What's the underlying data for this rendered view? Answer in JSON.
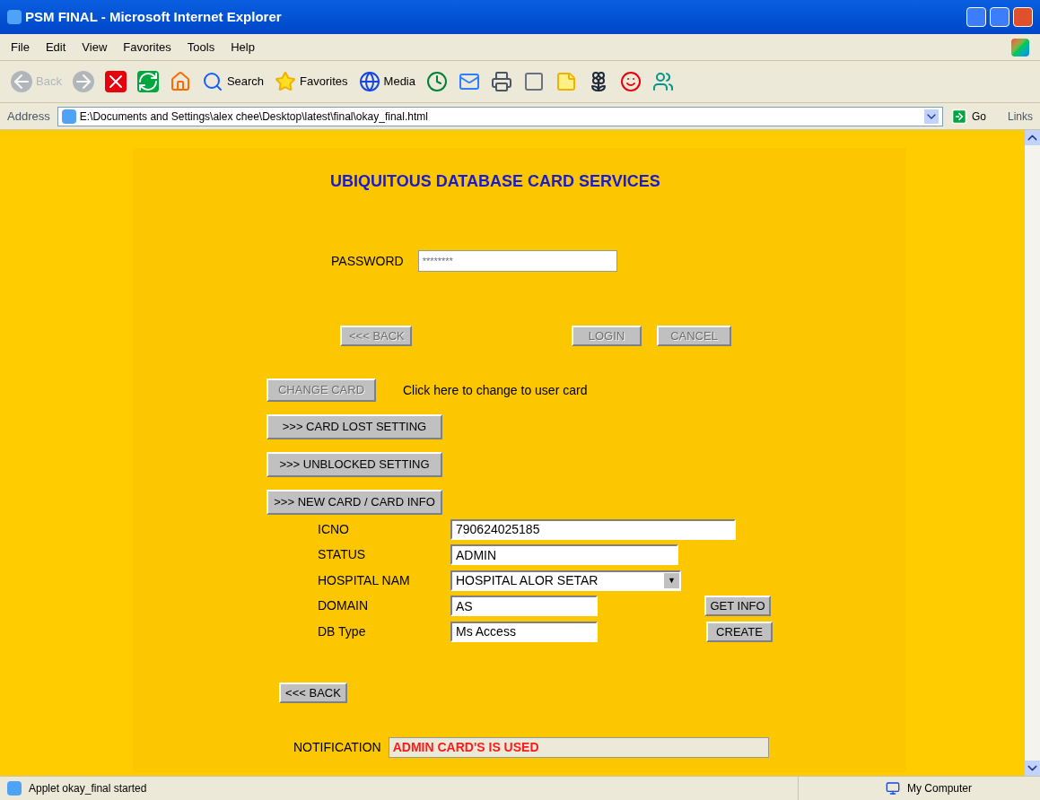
{
  "window": {
    "title": "PSM FINAL - Microsoft Internet Explorer"
  },
  "menu": [
    "File",
    "Edit",
    "View",
    "Favorites",
    "Tools",
    "Help"
  ],
  "toolbar": [
    {
      "kind": "back",
      "label": "Back",
      "disabled": true
    },
    {
      "kind": "forward",
      "disabled": true
    },
    {
      "kind": "stop",
      "disabled": false
    },
    {
      "kind": "refresh",
      "disabled": false
    },
    {
      "kind": "home",
      "disabled": false
    },
    {
      "kind": "search",
      "label": "Search",
      "disabled": false
    },
    {
      "kind": "favorites",
      "label": "Favorites",
      "disabled": false
    },
    {
      "kind": "media",
      "label": "Media",
      "disabled": false
    },
    {
      "kind": "history",
      "disabled": false
    },
    {
      "kind": "mail",
      "disabled": false
    },
    {
      "kind": "print",
      "disabled": false
    },
    {
      "kind": "edit",
      "disabled": false
    },
    {
      "kind": "note",
      "disabled": false
    },
    {
      "kind": "flower",
      "disabled": false
    },
    {
      "kind": "messenger",
      "disabled": false
    },
    {
      "kind": "people",
      "disabled": false
    }
  ],
  "address": {
    "label": "Address",
    "url": "E:\\Documents and Settings\\alex chee\\Desktop\\latest\\final\\okay_final.html",
    "go": "Go",
    "links": "Links"
  },
  "applet": {
    "heading": "UBIQUITOUS DATABASE CARD SERVICES",
    "password": {
      "label": "PASSWORD",
      "value": "********",
      "disabled": true
    },
    "login_buttons": [
      {
        "label": "<<< BACK",
        "disabled": true
      },
      {
        "label": "LOGIN",
        "disabled": true
      },
      {
        "label": "CANCEL",
        "disabled": true
      }
    ],
    "change_card": {
      "label": "CHANGE CARD",
      "disabled": true,
      "hint": "Click here to change to user card"
    },
    "menu_buttons": [
      {
        "label": ">>> CARD LOST SETTING",
        "disabled": false
      },
      {
        "label": ">>> UNBLOCKED SETTING",
        "disabled": false
      },
      {
        "label": ">>> NEW CARD / CARD INFO",
        "disabled": false
      }
    ],
    "fields": [
      {
        "kind": "text",
        "label": "ICNO",
        "value": "790624025185"
      },
      {
        "kind": "text",
        "label": "STATUS",
        "value": "ADMIN"
      },
      {
        "kind": "select",
        "label": "HOSPITAL NAM",
        "value": "HOSPITAL ALOR SETAR",
        "arrow": "▼"
      },
      {
        "kind": "text",
        "label": "DOMAIN",
        "value": "AS",
        "button": "GET INFO"
      },
      {
        "kind": "text",
        "label": "DB Type",
        "value": "Ms Access",
        "button": "CREATE"
      }
    ],
    "back": {
      "label": "<<< BACK",
      "disabled": false
    },
    "notification": {
      "label": "NOTIFICATION",
      "value": "ADMIN CARD'S IS USED"
    }
  },
  "status_bar": {
    "text": "Applet okay_final started",
    "zone": "My Computer"
  }
}
